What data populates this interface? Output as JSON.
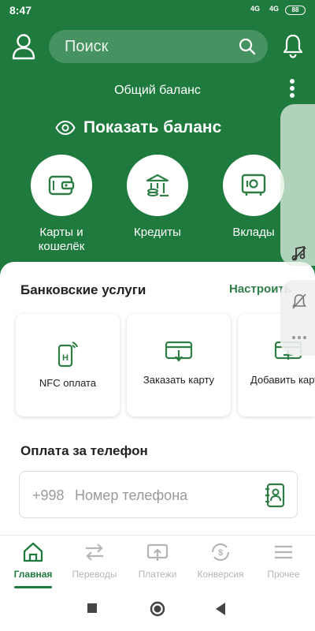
{
  "status": {
    "time": "8:47",
    "signal1": "4G",
    "signal2": "4G",
    "battery": "88"
  },
  "header": {
    "search_placeholder": "Поиск",
    "balance_caption": "Общий баланс",
    "show_balance": "Показать баланс"
  },
  "quick_actions": [
    {
      "label": "Карты и\nкошелёк",
      "icon": "wallet-icon"
    },
    {
      "label": "Кредиты",
      "icon": "bank-coins-icon"
    },
    {
      "label": "Вклады",
      "icon": "safe-icon"
    }
  ],
  "bank_services": {
    "title": "Банковские услуги",
    "configure": "Настроить",
    "items": [
      {
        "label": "NFC оплата",
        "icon": "nfc-phone-icon"
      },
      {
        "label": "Заказать карту",
        "icon": "order-card-icon"
      },
      {
        "label": "Добавить карту",
        "icon": "add-card-icon"
      }
    ]
  },
  "phone_payment": {
    "title": "Оплата за телефон",
    "prefix": "+998",
    "placeholder": "Номер телефона"
  },
  "bottom_nav": [
    {
      "label": "Главная",
      "icon": "home-icon",
      "active": true
    },
    {
      "label": "Переводы",
      "icon": "transfer-icon",
      "active": false
    },
    {
      "label": "Платежи",
      "icon": "payments-icon",
      "active": false
    },
    {
      "label": "Конверсия",
      "icon": "conversion-icon",
      "active": false
    },
    {
      "label": "Прочее",
      "icon": "menu-icon",
      "active": false
    }
  ],
  "colors": {
    "brand": "#1e7a3d",
    "accent_text": "#2e7d45",
    "inactive": "#b5b5b5"
  }
}
